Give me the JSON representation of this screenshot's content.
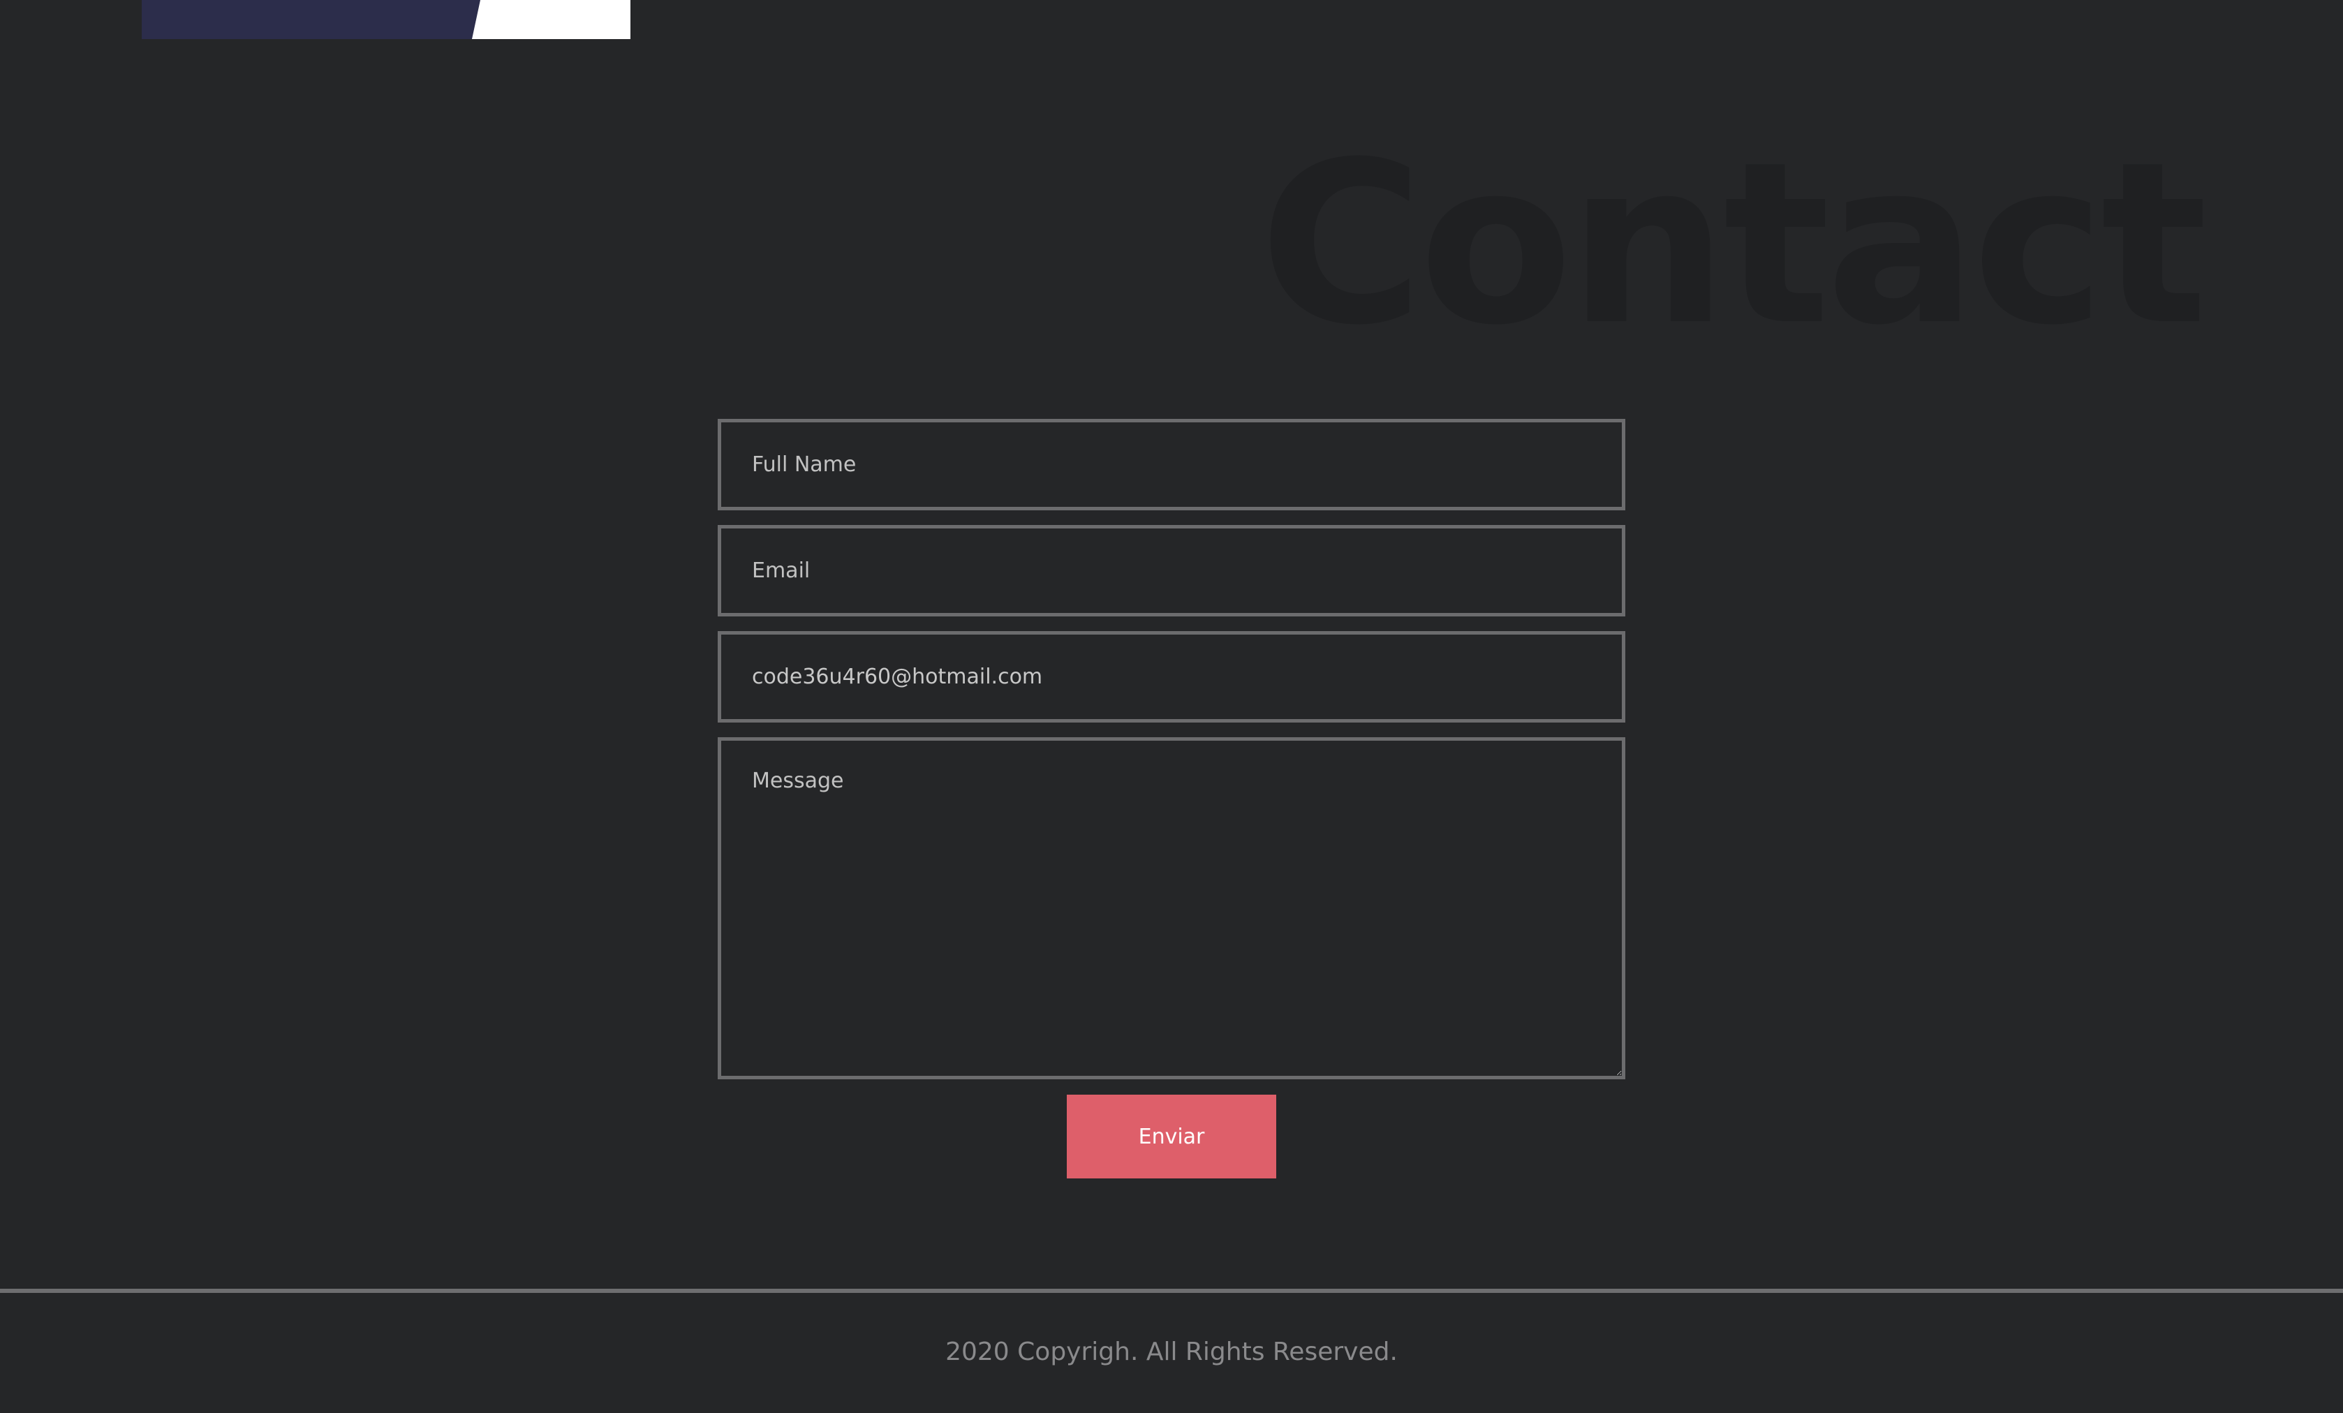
{
  "section": {
    "title": "Contact"
  },
  "form": {
    "fields": [
      {
        "placeholder": "Full Name",
        "value": ""
      },
      {
        "placeholder": "Email",
        "value": ""
      },
      {
        "placeholder": "",
        "value": "code36u4r60@hotmail.com"
      }
    ],
    "message": {
      "placeholder": "Message"
    },
    "submit_label": "Enviar"
  },
  "footer": {
    "copyright": "2020 Copyrigh. All Rights Reserved."
  },
  "colors": {
    "background": "#252628",
    "accent_button": "#de5f6a",
    "field_border": "#6c6c6e",
    "banner_dark": "#2c2d4b"
  }
}
